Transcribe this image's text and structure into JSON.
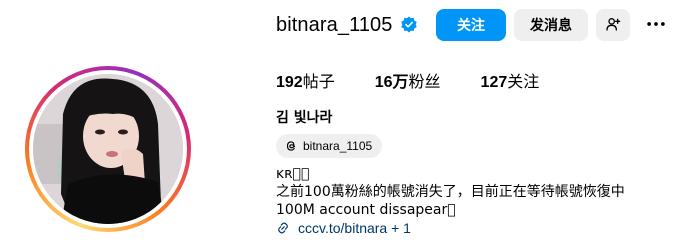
{
  "profile": {
    "username": "bitnara_1105",
    "full_name": "김 빛나라",
    "follow_label": "关注",
    "message_label": "发消息",
    "stats": {
      "posts_count": "192",
      "posts_label": "帖子",
      "followers_count": "16万",
      "followers_label": "粉丝",
      "following_count": "127",
      "following_label": "关注"
    },
    "threads_handle": "bitnara_1105",
    "bio_lines": [
      "ᴋʀ􀀀􀀀",
      "之前100萬粉絲的帳號消失了，目前正在等待帳號恢復中",
      "100M account dissapear􀀀"
    ],
    "link_text": "cccv.to/bitnara + 1"
  },
  "icons": {
    "verified": "verified-badge-icon",
    "suggest": "add-person-icon",
    "more": "more-options-icon",
    "threads": "threads-icon",
    "link": "link-icon"
  },
  "colors": {
    "primary": "#0095f6",
    "secondary_button": "#efefef",
    "link": "#00376b"
  }
}
